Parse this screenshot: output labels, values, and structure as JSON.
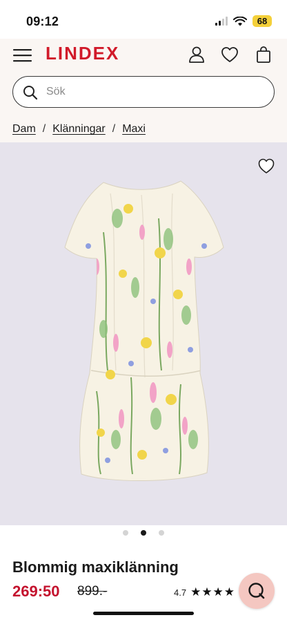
{
  "status_bar": {
    "time": "09:12",
    "battery": "68"
  },
  "header": {
    "logo": "LINDEX"
  },
  "search": {
    "placeholder": "Sök"
  },
  "breadcrumb": [
    {
      "label": "Dam"
    },
    {
      "label": "Klänningar"
    },
    {
      "label": "Maxi"
    }
  ],
  "breadcrumb_separator": "/",
  "carousel": {
    "count": 3,
    "active_index": 1
  },
  "product": {
    "title": "Blommig maxiklänning",
    "price": "269:50",
    "original_price": "899.-",
    "rating": "4.7",
    "stars": "★★★★"
  },
  "colors": {
    "brand": "#d11a2a",
    "price": "#c4122e",
    "chat_bg": "#f4c7c1",
    "header_bg": "#faf6f3",
    "image_bg": "#e6e3ec"
  }
}
